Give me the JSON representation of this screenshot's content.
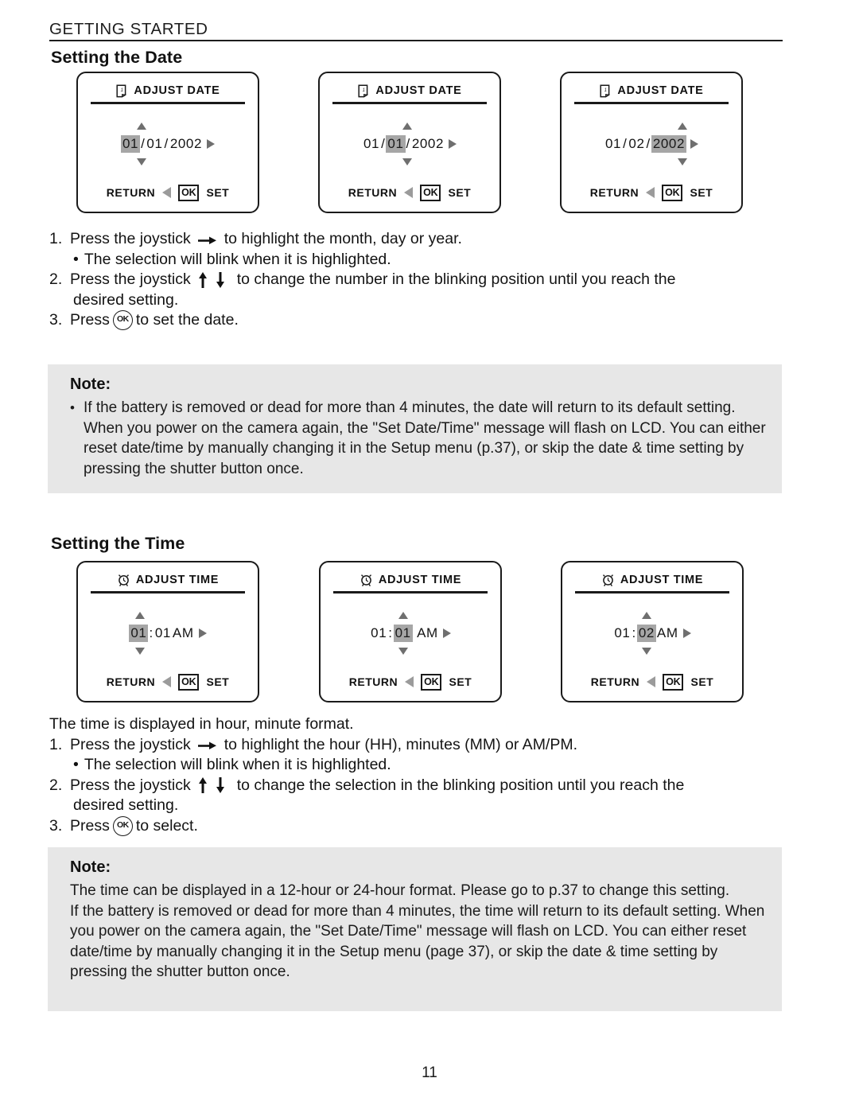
{
  "header": {
    "running_head": "GETTING STARTED"
  },
  "sections": {
    "date": {
      "title": "Setting the Date",
      "screens": [
        {
          "icon": "calendar-icon",
          "title": "ADJUST DATE",
          "segments": [
            {
              "text": "01",
              "selected": true
            },
            {
              "text": "/",
              "selected": false
            },
            {
              "text": "01",
              "selected": false
            },
            {
              "text": "/",
              "selected": false
            },
            {
              "text": "2002",
              "selected": false
            }
          ],
          "caret_index": 0,
          "return_label": "RETURN",
          "ok_key": "OK",
          "set_label": "SET"
        },
        {
          "icon": "calendar-icon",
          "title": "ADJUST DATE",
          "segments": [
            {
              "text": "01",
              "selected": false
            },
            {
              "text": "/",
              "selected": false
            },
            {
              "text": "01",
              "selected": true
            },
            {
              "text": "/",
              "selected": false
            },
            {
              "text": "2002",
              "selected": false
            }
          ],
          "caret_index": 2,
          "return_label": "RETURN",
          "ok_key": "OK",
          "set_label": "SET"
        },
        {
          "icon": "calendar-icon",
          "title": "ADJUST DATE",
          "segments": [
            {
              "text": "01",
              "selected": false
            },
            {
              "text": "/",
              "selected": false
            },
            {
              "text": "02",
              "selected": false
            },
            {
              "text": "/",
              "selected": false
            },
            {
              "text": "2002",
              "selected": true
            }
          ],
          "caret_index": 4,
          "return_label": "RETURN",
          "ok_key": "OK",
          "set_label": "SET"
        }
      ],
      "steps": [
        {
          "num": "1.",
          "pre": "Press the joystick",
          "glyph": "arrow-right-icon",
          "post": "to highlight the month, day or year."
        },
        {
          "num": "2.",
          "pre": "Press the joystick",
          "glyph": "arrow-up-down-icon",
          "post": "to change the number in the blinking position until you reach the",
          "cont": "desired setting."
        },
        {
          "num": "3.",
          "pre": "Press",
          "glyph": "ok-button-icon",
          "post": "to set the date."
        }
      ],
      "substep": "The selection will blink when it is highlighted.",
      "substep_bullet": "•"
    },
    "time": {
      "title": "Setting the Time",
      "screens": [
        {
          "icon": "alarm-clock-icon",
          "title": "ADJUST TIME",
          "segments": [
            {
              "text": "01",
              "selected": true
            },
            {
              "text": ":",
              "selected": false
            },
            {
              "text": "01",
              "selected": false
            },
            {
              "text": "AM",
              "selected": false
            }
          ],
          "caret_index": 0,
          "return_label": "RETURN",
          "ok_key": "OK",
          "set_label": "SET"
        },
        {
          "icon": "alarm-clock-icon",
          "title": "ADJUST TIME",
          "segments": [
            {
              "text": "01",
              "selected": false
            },
            {
              "text": ":",
              "selected": false
            },
            {
              "text": "01",
              "selected": true
            },
            {
              "text": " AM",
              "selected": false
            }
          ],
          "caret_index": 2,
          "return_label": "RETURN",
          "ok_key": "OK",
          "set_label": "SET"
        },
        {
          "icon": "alarm-clock-icon",
          "title": "ADJUST TIME",
          "segments": [
            {
              "text": "01",
              "selected": false
            },
            {
              "text": ":",
              "selected": false
            },
            {
              "text": "02",
              "selected": true
            },
            {
              "text": "AM",
              "selected": false
            }
          ],
          "caret_index": 2,
          "return_label": "RETURN",
          "ok_key": "OK",
          "set_label": "SET"
        }
      ],
      "lead": "The time is displayed in hour, minute format.",
      "steps": [
        {
          "num": "1.",
          "pre": "Press the joystick",
          "glyph": "arrow-right-icon",
          "post": "to highlight the hour (HH), minutes (MM) or AM/PM."
        },
        {
          "num": "2.",
          "pre": "Press the joystick",
          "glyph": "arrow-up-down-icon",
          "post": "to change the selection in the blinking position until you reach the",
          "cont": "desired setting."
        },
        {
          "num": "3.",
          "pre": "Press",
          "glyph": "ok-button-icon",
          "post": "to select."
        }
      ],
      "substep": "The selection will blink when it is highlighted.",
      "substep_bullet": "•"
    }
  },
  "notes": {
    "date_note": {
      "title": "Note:",
      "bullet": "•",
      "text": "If the battery is removed or dead for more than 4 minutes, the date will return to its default setting. When you power on the camera again, the \"Set Date/Time\" message will flash on LCD. You can either reset date/time by manually changing it in the Setup menu (p.37), or skip the date & time setting by pressing the shutter button once."
    },
    "time_note": {
      "title": "Note:",
      "paragraph1": "The time can be displayed in a 12-hour or 24-hour format.  Please go to p.37 to change this setting.",
      "paragraph2": "If the battery is removed or dead for more than 4 minutes, the time will return to its default setting. When you power on the camera again, the \"Set Date/Time\" message will flash on LCD. You can either reset date/time by manually changing it in the Setup menu (page 37), or skip the date & time setting by pressing the shutter button once."
    }
  },
  "footer": {
    "page_number": "11"
  },
  "colors": {
    "note_bg": "#e7e7e7",
    "highlight": "#a6a6a6",
    "ink": "#111111",
    "arrow_gray": "#6f6f6f"
  }
}
